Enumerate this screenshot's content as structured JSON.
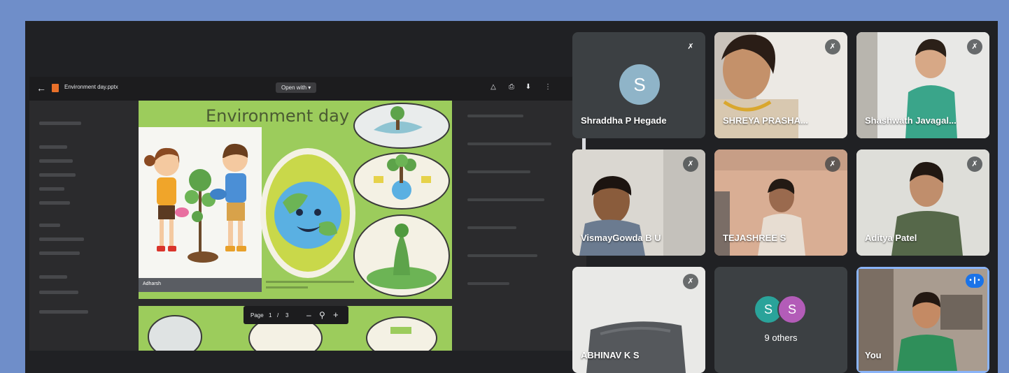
{
  "viewer": {
    "file_name": "Environment day.pptx",
    "open_with": "Open with ▾",
    "page_label": "Page",
    "page_number": "1",
    "page_sep": "/",
    "page_total": "3",
    "zoom_out": "–",
    "zoom_in": "+"
  },
  "slide": {
    "title": "Environment day",
    "caption": "Adharsh"
  },
  "participants": [
    {
      "name": "Shraddha P Hegade",
      "initial": "S",
      "type": "avatar"
    },
    {
      "name": "SHREYA PRASHA...",
      "type": "video"
    },
    {
      "name": "Shashwath Javagal...",
      "type": "video"
    },
    {
      "name": "VismayGowda B U",
      "type": "video"
    },
    {
      "name": "TEJASHREE S",
      "type": "video"
    },
    {
      "name": "Aditya Patel",
      "type": "video"
    },
    {
      "name": "ABHINAV K S",
      "type": "video"
    },
    {
      "name": "9 others",
      "type": "others",
      "initials": [
        "S",
        "S"
      ]
    },
    {
      "name": "You",
      "type": "self"
    }
  ],
  "icons": {
    "mic_off": "mic-off-icon",
    "speaking": "audio-level-icon"
  },
  "colors": {
    "frame": "#6f8ec9",
    "meet_bg": "#202124",
    "slide_green": "#9ccc5c",
    "tile_bg": "#3c4043",
    "active_border": "#8ab4f8",
    "speaking_badge": "#1a73e8"
  }
}
